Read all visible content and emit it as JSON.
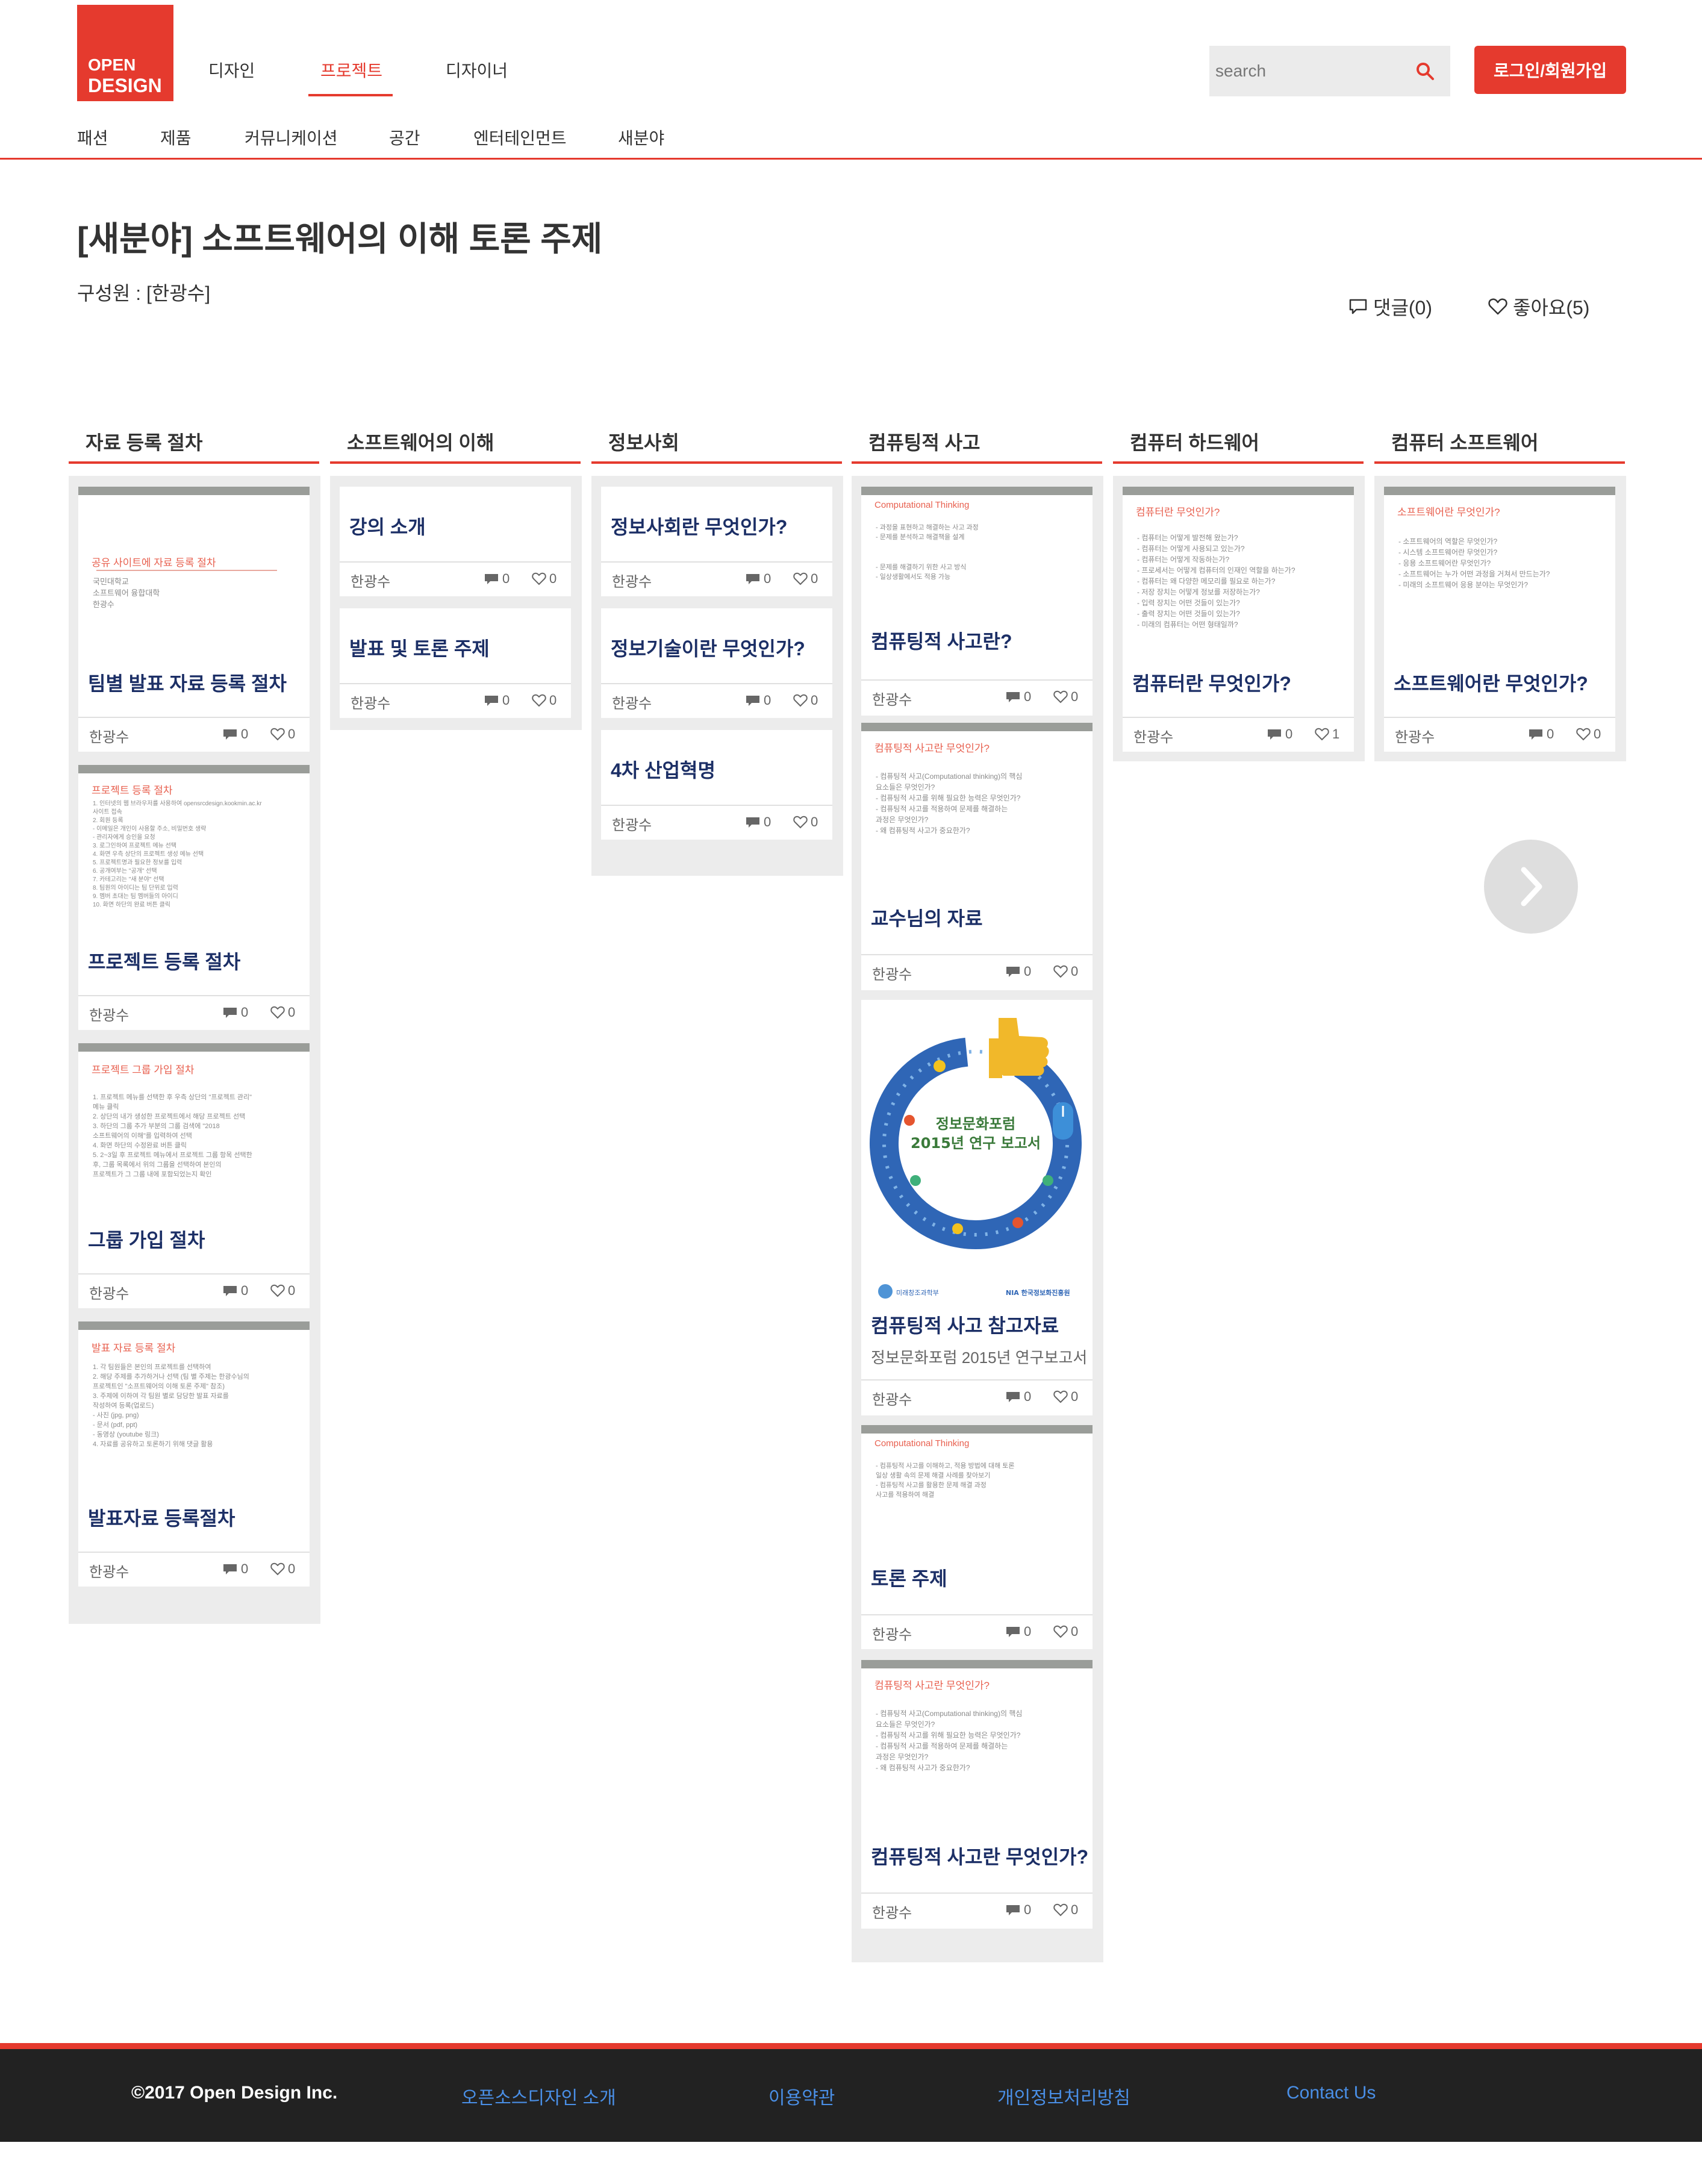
{
  "brand": {
    "line1": "OPEN",
    "line2": "DESIGN",
    "color": "#e53a2e"
  },
  "topnav": [
    "디자인",
    "프로젝트",
    "디자이너"
  ],
  "topnav_active": "프로젝트",
  "search": {
    "placeholder": "search"
  },
  "login_label": "로그인/회원가입",
  "subnav": [
    "패션",
    "제품",
    "커뮤니케이션",
    "공간",
    "엔터테인먼트",
    "새분야"
  ],
  "project": {
    "title": "[새분야] 소프트웨어의 이해 토론 주제",
    "members_label": "구성원 : [한광수]",
    "comments": "댓글(0)",
    "likes": "좋아요(5)"
  },
  "columns": [
    {
      "title": "자료 등록 절차",
      "cards": [
        {
          "title": "팀별 발표 자료 등록 절차",
          "author": "한광수",
          "comments": "0",
          "likes": "0",
          "thumb": {
            "heading": "공유 사이트에 자료 등록 절차",
            "lines": [
              "국민대학교",
              "소프트웨어 융합대학",
              "한광수"
            ]
          }
        },
        {
          "title": "프로젝트 등록 절차",
          "author": "한광수",
          "comments": "0",
          "likes": "0",
          "thumb": {
            "heading": "프로젝트 등록 절차",
            "lines": [
              "1. 인터넷의 웹 브라우저를 사용하여 opensrcdesign.kookmin.ac.kr",
              "   사이트 접속",
              "2. 회원 등록",
              "   - 이메일은 개인이 사용할 주소, 비밀번호 생략",
              "   - 관리자에게 승인을 요청",
              "3. 로그인하여 프로젝트 메뉴 선택",
              "4. 화면 우측 상단의 프로젝트 생성 메뉴 선택",
              "5. 프로젝트명과 필요한 정보를 입력",
              "6. 공개여부는 \"공개\" 선택",
              "7. 카테고리는 \"새 분야\" 선택",
              "8. 팀원의 아이디는 팀 단위로 입력",
              "9. 멤버 초대는 팀 멤버들의 아이디",
              "10. 화면 하단의 완료 버튼 클릭"
            ]
          }
        },
        {
          "title": "그룹 가입 절차",
          "author": "한광수",
          "comments": "0",
          "likes": "0",
          "thumb": {
            "heading": "프로젝트 그룹 가입 절차",
            "lines": [
              "1. 프로젝트 메뉴를 선택한 후 우측 상단의 \"프로젝트 관리\"",
              "   메뉴 클릭",
              "2. 상단의 내가 생성한 프로젝트에서 해당 프로젝트 선택",
              "3. 하단의 그룹 추가 부분의 그룹 검색에 \"2018",
              "   소프트웨어의 이해\"를 입력하여 선택",
              "4. 화면 하단의 수정완료 버튼 클릭",
              "5. 2~3일 후 프로젝트 메뉴에서 프로젝트 그룹 항목 선택한",
              "   후, 그룹 목록에서 위의 그룹을 선택하여 본인의",
              "   프로젝트가 그 그룹 내에 포함되었는지 확인"
            ]
          }
        },
        {
          "title": "발표자료 등록절차",
          "author": "한광수",
          "comments": "0",
          "likes": "0",
          "thumb": {
            "heading": "발표 자료 등록 절차",
            "lines": [
              "1. 각 팀원들은 본인의 프로젝트를 선택하여",
              "2. 해당 주제를 추가하거나 선택 (팀 별 주제는 한광수님의",
              "   프로젝트인 \"소프트웨어의 이해 토론 주제\" 참조)",
              "3. 주제에 이하여 각 팀원 별로 담당한 발표 자료를",
              "   작성하여 등록(업로드)",
              "   - 사진 (jpg, png)",
              "   - 문서 (pdf, ppt)",
              "   - 동영상 (youtube 링크)",
              "4. 자료를 공유하고 토론하기 위해 댓글 활용"
            ]
          }
        }
      ]
    },
    {
      "title": "소프트웨어의 이해",
      "cards": [
        {
          "title": "강의 소개",
          "author": "한광수",
          "comments": "0",
          "likes": "0"
        },
        {
          "title": "발표 및 토론 주제",
          "author": "한광수",
          "comments": "0",
          "likes": "0"
        }
      ]
    },
    {
      "title": "정보사회",
      "cards": [
        {
          "title": "정보사회란 무엇인가?",
          "author": "한광수",
          "comments": "0",
          "likes": "0"
        },
        {
          "title": "정보기술이란 무엇인가?",
          "author": "한광수",
          "comments": "0",
          "likes": "0"
        },
        {
          "title": "4차 산업혁명",
          "author": "한광수",
          "comments": "0",
          "likes": "0"
        }
      ]
    },
    {
      "title": "컴퓨팅적 사고",
      "cards": [
        {
          "title": "컴퓨팅적 사고란?",
          "author": "한광수",
          "comments": "0",
          "likes": "0",
          "thumb": {
            "heading": "Computational Thinking",
            "lines": [
              "- 과정을 표현하고 해결하는 사고 과정",
              "- 문제를 분석하고 해결책을 설계",
              "",
              "- 문제를 해결하기 위한 사고 방식",
              "- 일상생활에서도 적용 가능"
            ]
          }
        },
        {
          "title": "교수님의 자료",
          "author": "한광수",
          "comments": "0",
          "likes": "0",
          "thumb": {
            "heading": "컴퓨팅적 사고란 무엇인가?",
            "lines": [
              "- 컴퓨팅적 사고(Computational thinking)의 핵심",
              "  요소들은 무엇인가?",
              "- 컴퓨팅적 사고를 위해 필요한 능력은 무엇인가?",
              "- 컴퓨팅적 사고를 적용하여 문제를 해결하는",
              "  과정은 무엇인가?",
              "- 왜 컴퓨팅적 사고가 중요한가?"
            ]
          }
        },
        {
          "title": "컴퓨팅적 사고 참고자료",
          "subtitle": "정보문화포럼 2015년 연구보고서",
          "author": "한광수",
          "comments": "0",
          "likes": "0",
          "thumb": {
            "line1": "정보문화포럼",
            "line2": "2015년 연구 보고서",
            "org1": "미래창조과학부",
            "org2": "NIA 한국정보화진흥원"
          }
        },
        {
          "title": "토론 주제",
          "author": "한광수",
          "comments": "0",
          "likes": "0",
          "thumb": {
            "heading": "Computational Thinking",
            "lines": [
              "- 컴퓨팅적 사고를 이해하고, 적용 방법에 대해 토론",
              "  일상 생활 속의 문제 해결 사례를 찾아보기",
              "- 컴퓨팅적 사고를 활용한 문제 해결 과정",
              "  사고를 적용하여 해결"
            ]
          }
        },
        {
          "title": "컴퓨팅적 사고란 무엇인가?",
          "author": "한광수",
          "comments": "0",
          "likes": "0",
          "thumb": {
            "heading": "컴퓨팅적 사고란 무엇인가?",
            "lines": [
              "- 컴퓨팅적 사고(Computational thinking)의 핵심",
              "  요소들은 무엇인가?",
              "- 컴퓨팅적 사고를 위해 필요한 능력은 무엇인가?",
              "- 컴퓨팅적 사고를 적용하여 문제를 해결하는",
              "  과정은 무엇인가?",
              "- 왜 컴퓨팅적 사고가 중요한가?"
            ]
          }
        }
      ]
    },
    {
      "title": "컴퓨터 하드웨어",
      "cards": [
        {
          "title": "컴퓨터란 무엇인가?",
          "author": "한광수",
          "comments": "0",
          "likes": "1",
          "thumb": {
            "heading": "컴퓨터란 무엇인가?",
            "lines": [
              "- 컴퓨터는 어떻게 발전해 왔는가?",
              "- 컴퓨터는 어떻게 사용되고 있는가?",
              "- 컴퓨터는 어떻게 작동하는가?",
              "  - 프로세서는 어떻게 컴퓨터의 인재인 역할을 하는가?",
              "  - 컴퓨터는 왜 다양한 메모리를 필요로 하는가?",
              "  - 저장 장치는 어떻게 정보를 저장하는가?",
              "  - 입력 장치는 어떤 것들이 있는가?",
              "  - 출력 장치는 어떤 것들이 있는가?",
              "- 미래의 컴퓨터는 어떤 형태일까?"
            ]
          }
        }
      ]
    },
    {
      "title": "컴퓨터 소프트웨어",
      "cards": [
        {
          "title": "소프트웨어란 무엇인가?",
          "author": "한광수",
          "comments": "0",
          "likes": "0",
          "thumb": {
            "heading": "소프트웨어란 무엇인가?",
            "lines": [
              "- 소프트웨어의 역할은 무엇인가?",
              "- 시스템 소프트웨어란 무엇인가?",
              "- 응용 소프트웨어란 무엇인가?",
              "- 소프트웨어는 누가 어떤 과정을 거쳐서 만드는가?",
              "- 미래의 소프트웨어 응용 분야는 무엇인가?"
            ]
          }
        }
      ]
    }
  ],
  "footer": {
    "copyright": "©2017 Open Design Inc.",
    "links": [
      "오픈소스디자인 소개",
      "이용약관",
      "개인정보처리방침",
      "Contact Us"
    ],
    "link_color": "#4a8fe6"
  },
  "icons": {
    "search": "search-icon",
    "comment": "comment-icon",
    "like": "heart-icon",
    "next": "chevron-right-icon"
  }
}
